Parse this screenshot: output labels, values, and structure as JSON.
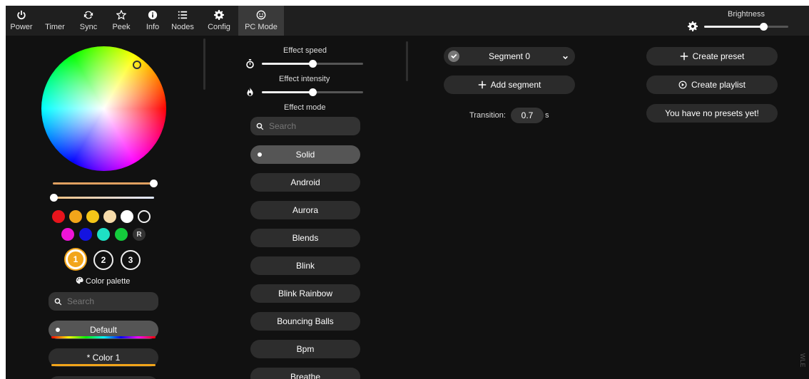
{
  "nav": {
    "items": [
      {
        "label": "Power",
        "icon": "power-icon"
      },
      {
        "label": "Timer",
        "icon": "moon-icon"
      },
      {
        "label": "Sync",
        "icon": "sync-icon"
      },
      {
        "label": "Peek",
        "icon": "star-icon"
      },
      {
        "label": "Info",
        "icon": "info-icon"
      },
      {
        "label": "Nodes",
        "icon": "list-icon"
      },
      {
        "label": "Config",
        "icon": "gear-icon"
      },
      {
        "label": "PC Mode",
        "icon": "smiley-icon"
      }
    ],
    "active": "PC Mode"
  },
  "brightness": {
    "label": "Brightness",
    "value": 0.7
  },
  "colors": {
    "slider_brightness_value": 1.0,
    "slider_white_value": 0.0,
    "swatches_row1": [
      "#e8141c",
      "#f2a51a",
      "#f5c518",
      "#f7dcaa",
      "#ffffff",
      "outline"
    ],
    "swatches_row2": [
      "#ee14d8",
      "#1414e0",
      "#1ee0c4",
      "#14cc3c"
    ],
    "random_label": "R",
    "slots": [
      "1",
      "2",
      "3"
    ],
    "selected_slot": "1"
  },
  "palette": {
    "label": "Color palette",
    "search_placeholder": "Search",
    "items": [
      "Default",
      "* Color 1"
    ]
  },
  "effects": {
    "speed_label": "Effect speed",
    "speed_value": 0.5,
    "intensity_label": "Effect intensity",
    "intensity_value": 0.5,
    "mode_label": "Effect mode",
    "search_placeholder": "Search",
    "items": [
      "Solid",
      "Android",
      "Aurora",
      "Blends",
      "Blink",
      "Blink Rainbow",
      "Bouncing Balls",
      "Bpm",
      "Breathe"
    ],
    "selected": "Solid"
  },
  "segments": {
    "segment_label": "Segment 0",
    "add_label": "Add segment",
    "transition_label": "Transition:",
    "transition_value": "0.7",
    "transition_unit": "s"
  },
  "presets": {
    "create_preset": "Create preset",
    "create_playlist": "Create playlist",
    "empty_message": "You have no presets yet!"
  },
  "watermark": "WLE"
}
